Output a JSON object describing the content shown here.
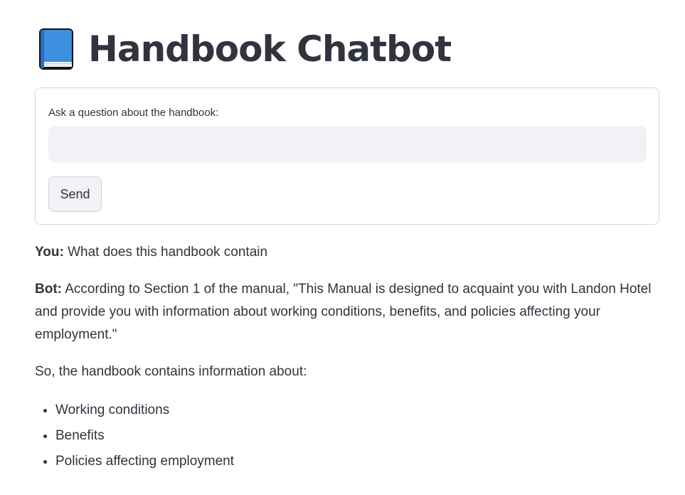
{
  "header": {
    "icon": "blue-book-icon",
    "title": "Handbook Chatbot"
  },
  "form": {
    "label": "Ask a question about the handbook:",
    "input_value": "",
    "send_label": "Send"
  },
  "conversation": {
    "user_speaker": "You:",
    "user_message": "What does this handbook contain",
    "bot_speaker": "Bot:",
    "bot_message": "According to Section 1 of the manual, \"This Manual is designed to acquaint you with Landon Hotel and provide you with information about working conditions, benefits, and policies affecting your employment.\"",
    "bot_followup": "So, the handbook contains information about:",
    "bot_list": [
      "Working conditions",
      "Benefits",
      "Policies affecting employment"
    ]
  },
  "colors": {
    "text": "#31333f",
    "input_bg": "#f0f2f6",
    "border": "#d6d6d9",
    "book_blue": "#3d8fe0"
  }
}
